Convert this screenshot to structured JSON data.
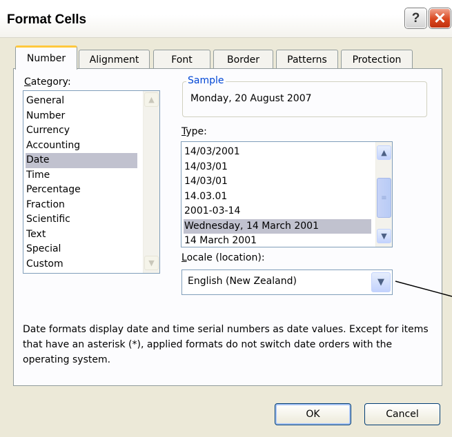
{
  "window": {
    "title": "Format Cells"
  },
  "titlebar": {
    "help_glyph": "?",
    "close_glyph": "✕"
  },
  "tabs": [
    {
      "label": "Number",
      "active": true
    },
    {
      "label": "Alignment",
      "active": false
    },
    {
      "label": "Font",
      "active": false
    },
    {
      "label": "Border",
      "active": false
    },
    {
      "label": "Patterns",
      "active": false
    },
    {
      "label": "Protection",
      "active": false
    }
  ],
  "category": {
    "label_accel": "C",
    "label_rest": "ategory:",
    "items": [
      "General",
      "Number",
      "Currency",
      "Accounting",
      "Date",
      "Time",
      "Percentage",
      "Fraction",
      "Scientific",
      "Text",
      "Special",
      "Custom"
    ],
    "selected": "Date"
  },
  "sample": {
    "legend": "Sample",
    "value": "Monday, 20 August 2007"
  },
  "type": {
    "label_accel": "T",
    "label_rest": "ype:",
    "items": [
      "14/03/2001",
      "14/03/01",
      "14/03/01",
      "14.03.01",
      "2001-03-14",
      "Wednesday, 14 March 2001",
      "14 March 2001"
    ],
    "selected": "Wednesday, 14 March 2001"
  },
  "locale": {
    "label_accel": "L",
    "label_rest": "ocale (location):",
    "value": "English (New Zealand)"
  },
  "description": "Date formats display date and time serial numbers as date values. Except for items that have an asterisk (*), applied formats do not switch date orders with the operating system.",
  "buttons": {
    "ok": "OK",
    "cancel": "Cancel"
  },
  "icons": {
    "up": "▲",
    "down": "▼",
    "grip": "≡"
  },
  "colors": {
    "legend": "#0046d5",
    "selection": "#c1c2cf",
    "active_tab_accent": "#ffc83c"
  }
}
